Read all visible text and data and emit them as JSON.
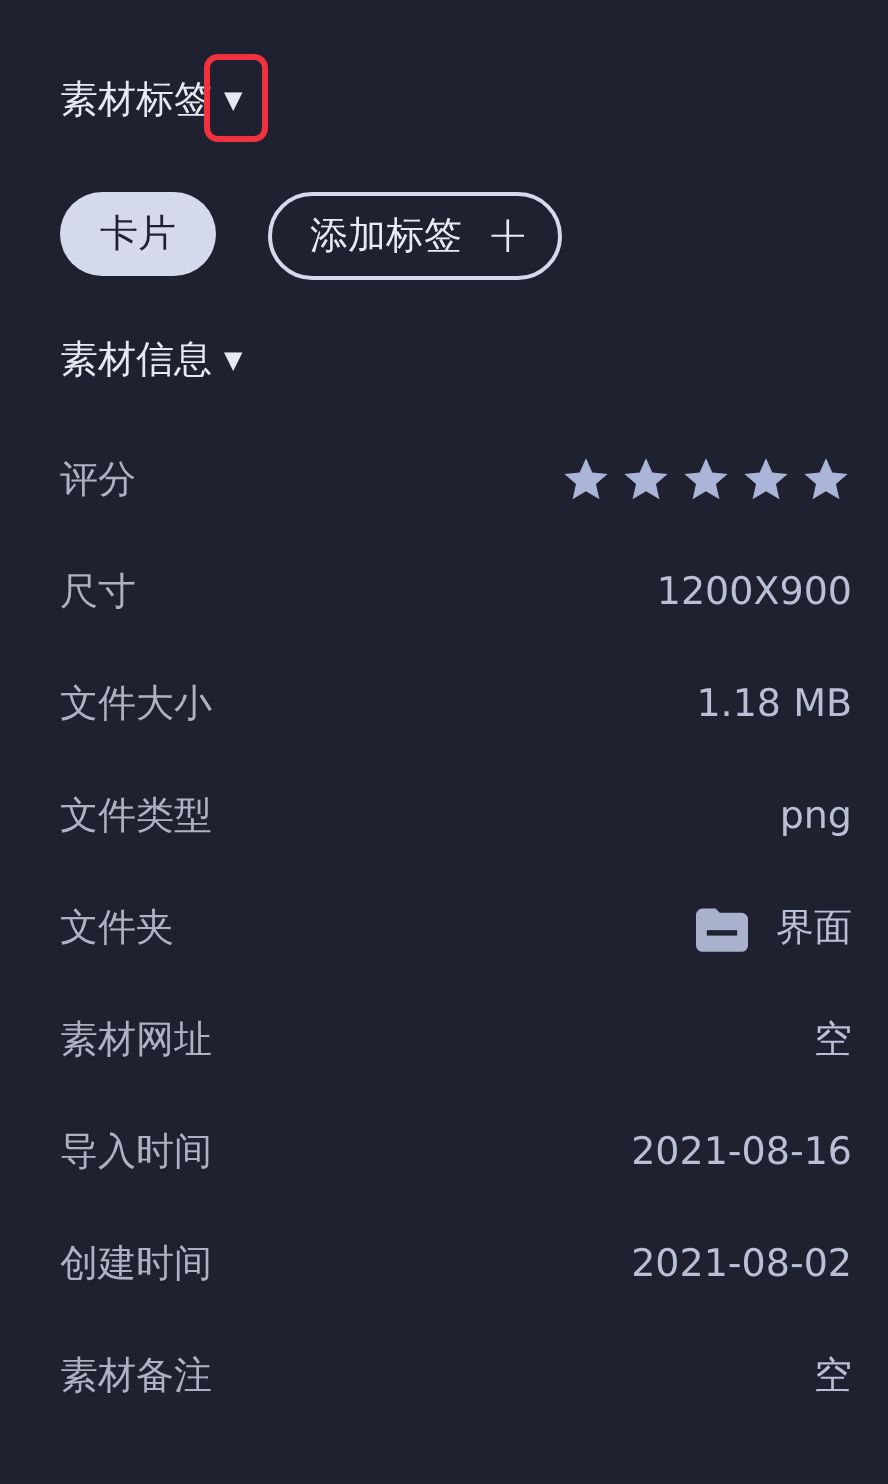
{
  "tags_section": {
    "title": "素材标签",
    "toggle": "▼",
    "highlighted": true
  },
  "tags": [
    {
      "label": "卡片",
      "kind": "tag"
    },
    {
      "label": "添加标签",
      "kind": "add",
      "icon": "+"
    }
  ],
  "info_section": {
    "title": "素材信息",
    "toggle": "▼"
  },
  "rows": [
    {
      "label": "评分",
      "kind": "stars",
      "stars": 5
    },
    {
      "label": "尺寸",
      "kind": "text",
      "value": "1200X900"
    },
    {
      "label": "文件大小",
      "kind": "text",
      "value": "1.18 MB"
    },
    {
      "label": "文件类型",
      "kind": "text",
      "value": "png"
    },
    {
      "label": "文件夹",
      "kind": "folder",
      "value": "界面"
    },
    {
      "label": "素材网址",
      "kind": "text",
      "value": "空"
    },
    {
      "label": "导入时间",
      "kind": "text",
      "value": "2021-08-16"
    },
    {
      "label": "创建时间",
      "kind": "text",
      "value": "2021-08-02"
    },
    {
      "label": "素材备注",
      "kind": "text",
      "value": "空"
    }
  ]
}
